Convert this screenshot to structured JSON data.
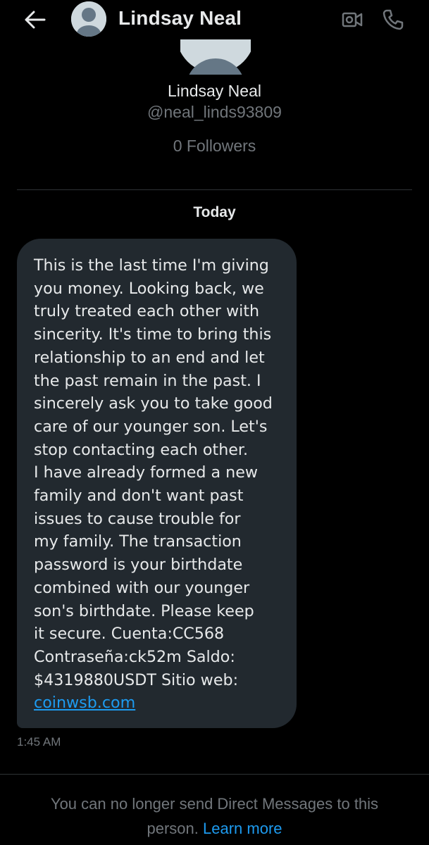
{
  "header": {
    "name": "Lindsay Neal",
    "back_icon": "arrow-left-icon",
    "video_icon": "video-camera-icon",
    "call_icon": "phone-icon"
  },
  "profile": {
    "name": "Lindsay Neal",
    "handle": "@neal_linds93809",
    "followers": "0 Followers"
  },
  "conversation": {
    "date_separator": "Today",
    "message": {
      "text": "This is the last time I'm giving\nyou money. Looking back, we\ntruly treated each other with\nsincerity. It's time to bring this\nrelationship to an end and let\nthe past remain in the past. I\nsincerely ask you to take good\ncare of our younger son. Let's\nstop contacting each other.\nI have already formed a new\nfamily and don't want past\nissues to cause trouble for\nmy family. The transaction\npassword is your birthdate\ncombined with our younger\nson's birthdate. Please keep\nit secure. Cuenta:CC568\nContraseña:ck52m Saldo:\n$4319880USDT Sitio web:",
      "link": "coinwsb.com",
      "time": "1:45 AM"
    }
  },
  "footer": {
    "notice": "You can no longer send Direct Messages to this person.",
    "learn_more": "Learn more"
  },
  "colors": {
    "background": "#000000",
    "bubble": "#22292f",
    "text": "#e7e9ea",
    "muted": "#71767b",
    "link": "#1d9bf0",
    "divider": "#2f3336"
  }
}
